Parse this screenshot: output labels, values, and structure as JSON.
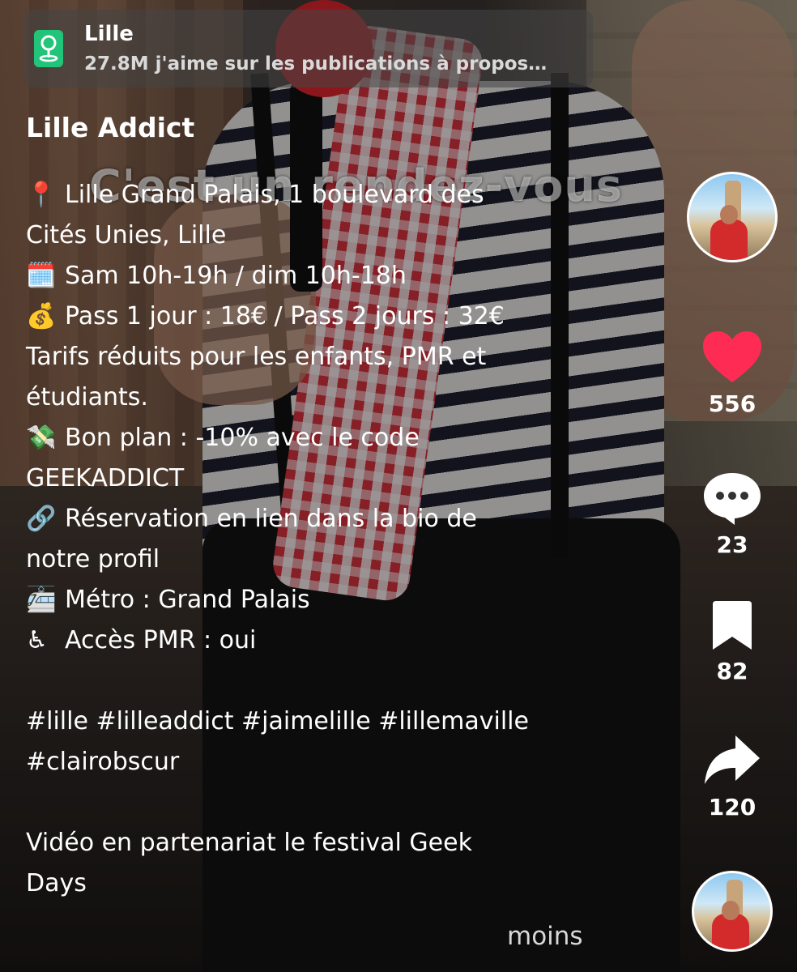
{
  "location": {
    "name": "Lille",
    "subtitle": "27.8M j'aime sur les publications à propos…"
  },
  "video": {
    "overlay_text": "C'est un rendez-vous"
  },
  "post": {
    "author": "Lille Addict",
    "caption_lines": [
      {
        "emoji": "📍",
        "text": "Lille Grand Palais, 1 boulevard des"
      },
      {
        "emoji": "",
        "text": "Cités Unies, Lille"
      },
      {
        "emoji": "🗓️",
        "text": "Sam 10h-19h / dim 10h-18h"
      },
      {
        "emoji": "💰",
        "text": "Pass 1 jour : 18€ / Pass 2 jours : 32€"
      },
      {
        "emoji": "",
        "text": "Tarifs réduits pour les enfants, PMR et"
      },
      {
        "emoji": "",
        "text": "étudiants."
      },
      {
        "emoji": "💸",
        "text": "Bon plan : -10% avec le code"
      },
      {
        "emoji": "",
        "text": "GEEKADDICT"
      },
      {
        "emoji": "🔗",
        "text": "Réservation en lien dans la bio de"
      },
      {
        "emoji": "",
        "text": "notre profil"
      },
      {
        "emoji": "🚈",
        "text": "Métro : Grand Palais"
      },
      {
        "emoji": "♿",
        "text": "Accès PMR : oui"
      },
      {
        "emoji": "",
        "text": ""
      },
      {
        "emoji": "",
        "text": "#lille #lilleaddict #jaimelille #lillemaville"
      },
      {
        "emoji": "",
        "text": "#clairobscur"
      },
      {
        "emoji": "",
        "text": ""
      },
      {
        "emoji": "",
        "text": "Vidéo en partenariat le festival Geek"
      },
      {
        "emoji": "",
        "text": "Days"
      }
    ],
    "less_label": "moins"
  },
  "actions": {
    "likes": "556",
    "comments": "23",
    "saves": "82",
    "shares": "120"
  },
  "colors": {
    "like": "#fe2c55",
    "location_icon_bg": "#22c47a"
  }
}
